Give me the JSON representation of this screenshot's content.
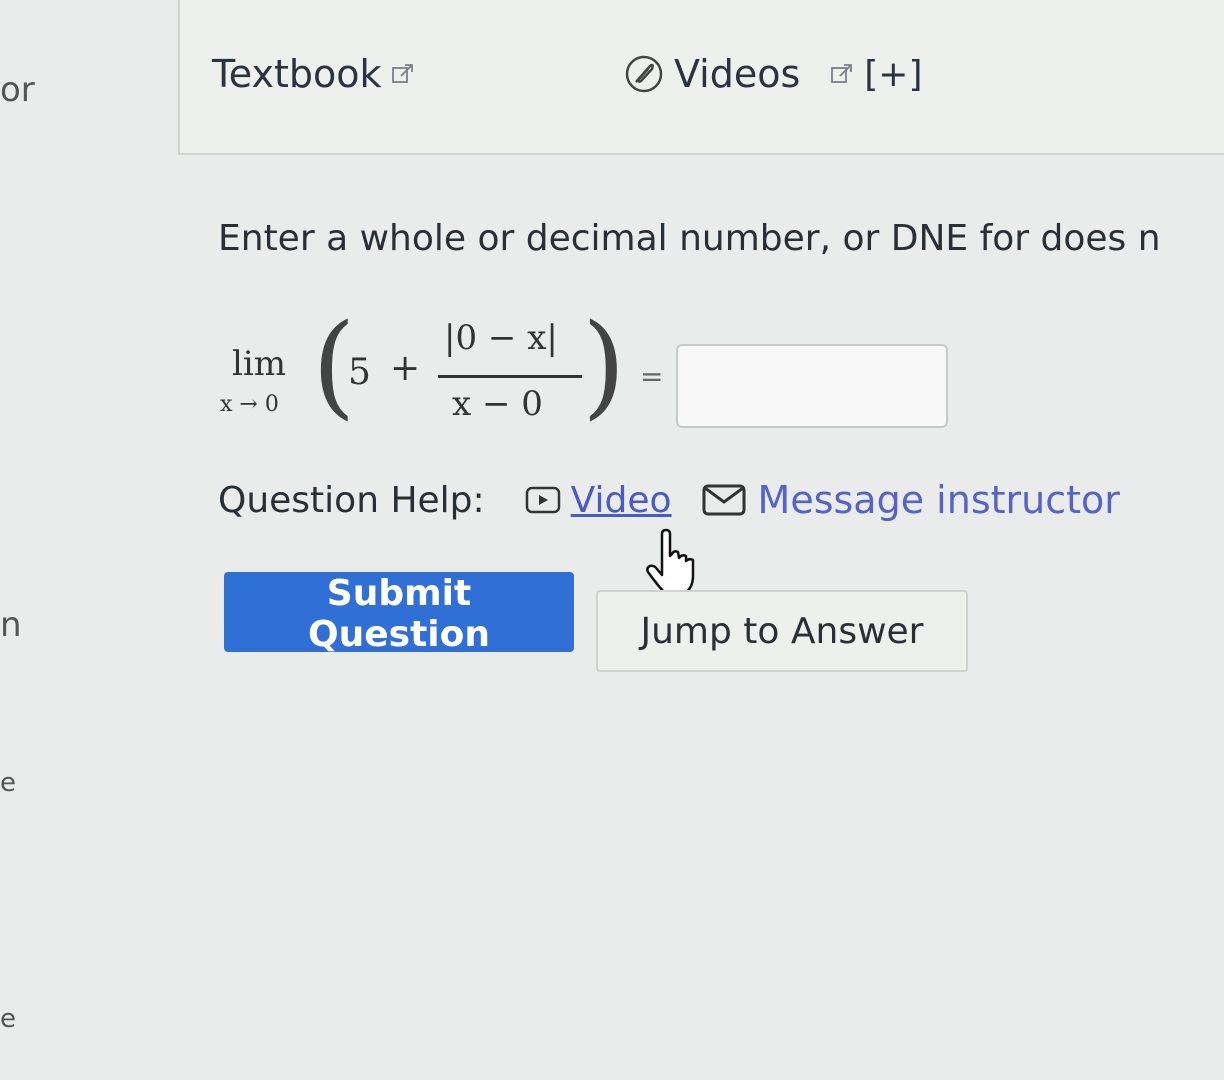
{
  "sidebar": {
    "fragments": [
      "or",
      "n",
      "e",
      "e"
    ]
  },
  "resources": {
    "textbook_label": "Textbook",
    "videos_label": "Videos",
    "expand_label": "[+]"
  },
  "question": {
    "instructions": "Enter a whole or decimal number, or DNE for does n",
    "math": {
      "lim": "lim",
      "lim_sub": "x → 0",
      "five": "5",
      "plus": "+",
      "numerator": "|0 − x|",
      "denominator": "x − 0",
      "equals": "="
    },
    "answer_value": ""
  },
  "help": {
    "label": "Question Help:",
    "video_label": "Video",
    "message_label": "Message instructor"
  },
  "buttons": {
    "submit_label": "Submit Question",
    "jump_label": "Jump to Answer"
  },
  "colors": {
    "accent": "#2f6fd6",
    "link": "#4a5cc4"
  }
}
